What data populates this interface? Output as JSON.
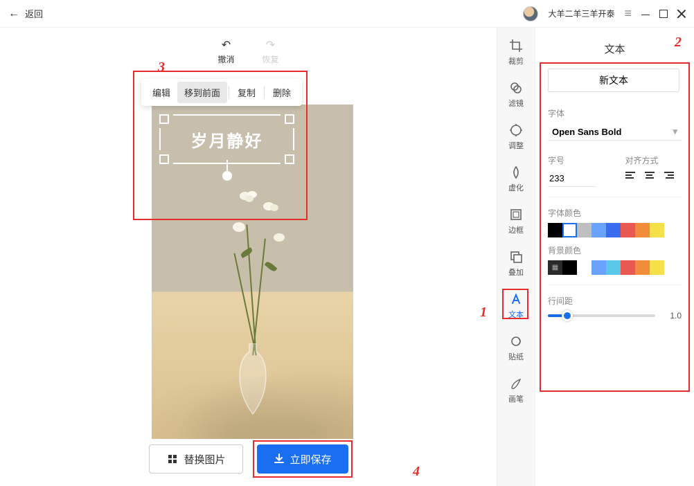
{
  "header": {
    "back": "返回",
    "username": "大羊二羊三羊开泰"
  },
  "undo_label": "撤消",
  "redo_label": "恢复",
  "edit_toolbar": {
    "edit": "编辑",
    "bring_front": "移到前面",
    "copy": "复制",
    "delete": "删除"
  },
  "caption_text": "岁月静好",
  "buttons": {
    "replace_image": "替换图片",
    "save_now": "立即保存"
  },
  "annotations": {
    "n1": "1",
    "n2": "2",
    "n3": "3",
    "n4": "4"
  },
  "tools": {
    "crop": "裁剪",
    "filter": "滤镜",
    "adjust": "调整",
    "blur": "虚化",
    "border": "边框",
    "overlay": "叠加",
    "text": "文本",
    "sticker": "贴纸",
    "brush": "画笔"
  },
  "panel": {
    "title": "文本",
    "new_text": "新文本",
    "font_label": "字体",
    "font_value": "Open Sans Bold",
    "size_label": "字号",
    "size_value": "233",
    "align_label": "对齐方式",
    "font_color_label": "字体颜色",
    "bg_color_label": "背景颜色",
    "line_spacing_label": "行间距",
    "line_spacing_value": "1.0",
    "font_colors": [
      "#000000",
      "#ffffff",
      "#bfbfbf",
      "#6aa2ff",
      "#3a6cf0",
      "#e85a4f",
      "#f08c3a",
      "#f5e04a"
    ],
    "bg_colors": [
      "transparent",
      "#000000",
      "#ffffff",
      "#6aa2ff",
      "#5ac6e8",
      "#e85a4f",
      "#f08c3a",
      "#f5e04a"
    ]
  }
}
